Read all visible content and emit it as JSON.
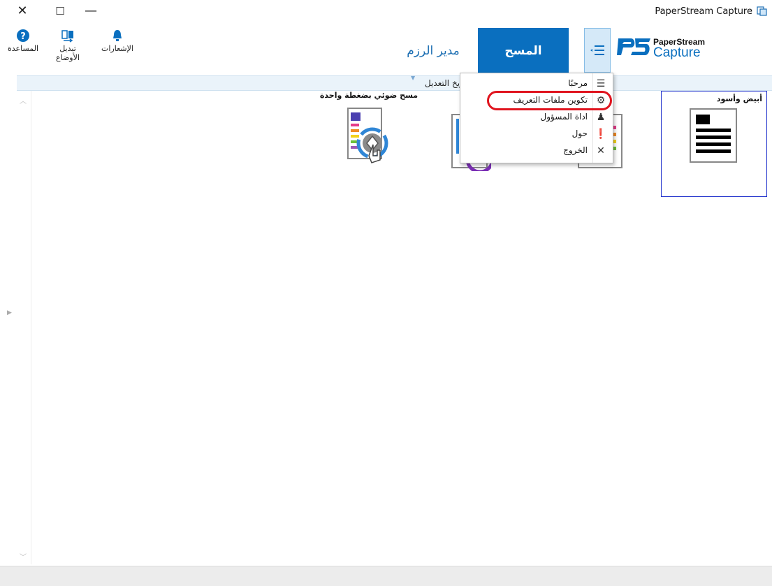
{
  "window": {
    "title": "PaperStream Capture",
    "controls": {
      "close": "✕",
      "maximize": "☐",
      "minimize": "—"
    }
  },
  "toolbar": {
    "help_label": "المساعدة",
    "switch_label": "تبديل الأوضاع",
    "notifications_label": "الإشعارات"
  },
  "tabs": {
    "batch_manager": "مدير الرزم",
    "scan": "المسح"
  },
  "logo": {
    "line1": "PaperStream",
    "line2": "Capture"
  },
  "column_header": {
    "sort_label": "تاريخ التعديل"
  },
  "profiles": [
    {
      "label": "مسح ضوئي بضغطة واحدة"
    },
    {
      "label": "أبيض وأسود"
    }
  ],
  "menu": {
    "items": [
      {
        "label": "مرحبًا",
        "icon": "list-icon"
      },
      {
        "label": "تكوين ملفات التعريف",
        "icon": "gear-icon"
      },
      {
        "label": "اداة المسؤول",
        "icon": "admin-icon"
      },
      {
        "label": "حول",
        "icon": "info-icon"
      },
      {
        "label": "الخروج",
        "icon": "close-icon"
      }
    ]
  },
  "colors": {
    "accent": "#0a6fbf",
    "highlight": "#e0141e",
    "selection_border": "#2233cc"
  }
}
